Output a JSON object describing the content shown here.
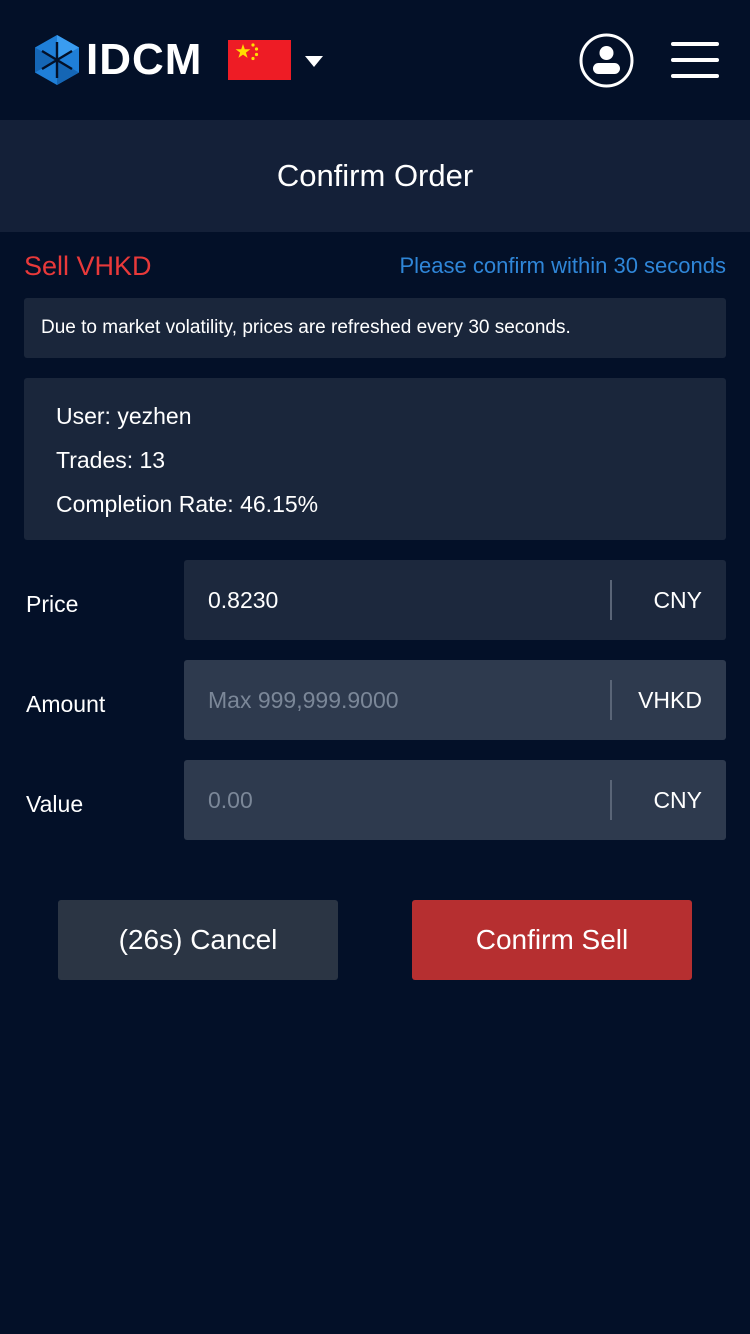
{
  "header": {
    "brand": "IDCM",
    "logo_icon": "idcm-hexagon-logo-icon",
    "flag_icon": "china-flag-icon",
    "language_dropdown_icon": "caret-down-icon",
    "account_icon": "user-account-icon",
    "menu_icon": "hamburger-menu-icon"
  },
  "page": {
    "title": "Confirm Order"
  },
  "order": {
    "side_title": "Sell VHKD",
    "timer_hint": "Please confirm within 30 seconds",
    "notice": "Due to market volatility, prices are refreshed every 30 seconds."
  },
  "counterparty": {
    "user_label": "User:",
    "user_value": "yezhen",
    "trades_label": "Trades:",
    "trades_value": "13",
    "completion_label": "Completion Rate:",
    "completion_value": "46.15%"
  },
  "form": {
    "price": {
      "label": "Price",
      "value": "0.8230",
      "unit": "CNY"
    },
    "amount": {
      "label": "Amount",
      "placeholder": "Max 999,999.9000",
      "unit": "VHKD"
    },
    "total": {
      "label": "Value",
      "placeholder": "0.00",
      "unit": "CNY"
    }
  },
  "actions": {
    "cancel_label": "(26s) Cancel",
    "confirm_label": "Confirm Sell"
  },
  "colors": {
    "background": "#031028",
    "sell_red": "#e8393a",
    "hint_blue": "#2f86d8",
    "confirm_button": "#b62f30",
    "cancel_button": "#2b3544"
  }
}
